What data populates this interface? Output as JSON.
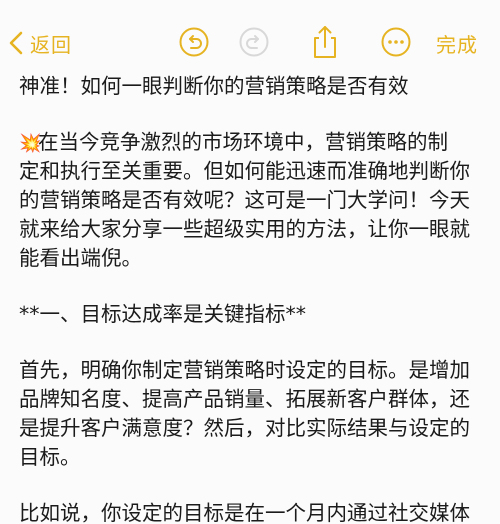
{
  "toolbar": {
    "back_label": "返回",
    "done_label": "完成",
    "accent_color": "#e6b422",
    "icons": [
      "chevron-left-icon",
      "undo-icon",
      "redo-icon",
      "share-icon",
      "more-icon"
    ]
  },
  "note": {
    "title": "神准！如何一眼判断你的营销策略是否有效",
    "intro_emoji": "💥",
    "intro_lines": [
      "在当今竞争激烈的市场环境中，营销策略的制",
      "定和执行至关重要。但如何能迅速而准确地判断你",
      "的营销策略是否有效呢？这可是一门大学问！今天",
      "就来给大家分享一些超级实用的方法，让你一眼就",
      "能看出端倪。"
    ],
    "section1_heading": "**一、目标达成率是关键指标**",
    "section1_lines": [
      "首先，明确你制定营销策略时设定的目标。是增加",
      "品牌知名度、提高产品销量、拓展新客户群体，还",
      "是提升客户满意度？然后，对比实际结果与设定的",
      "目标。"
    ],
    "cut_line": "比如说，你设定的目标是在一个月内通过社交媒体"
  }
}
